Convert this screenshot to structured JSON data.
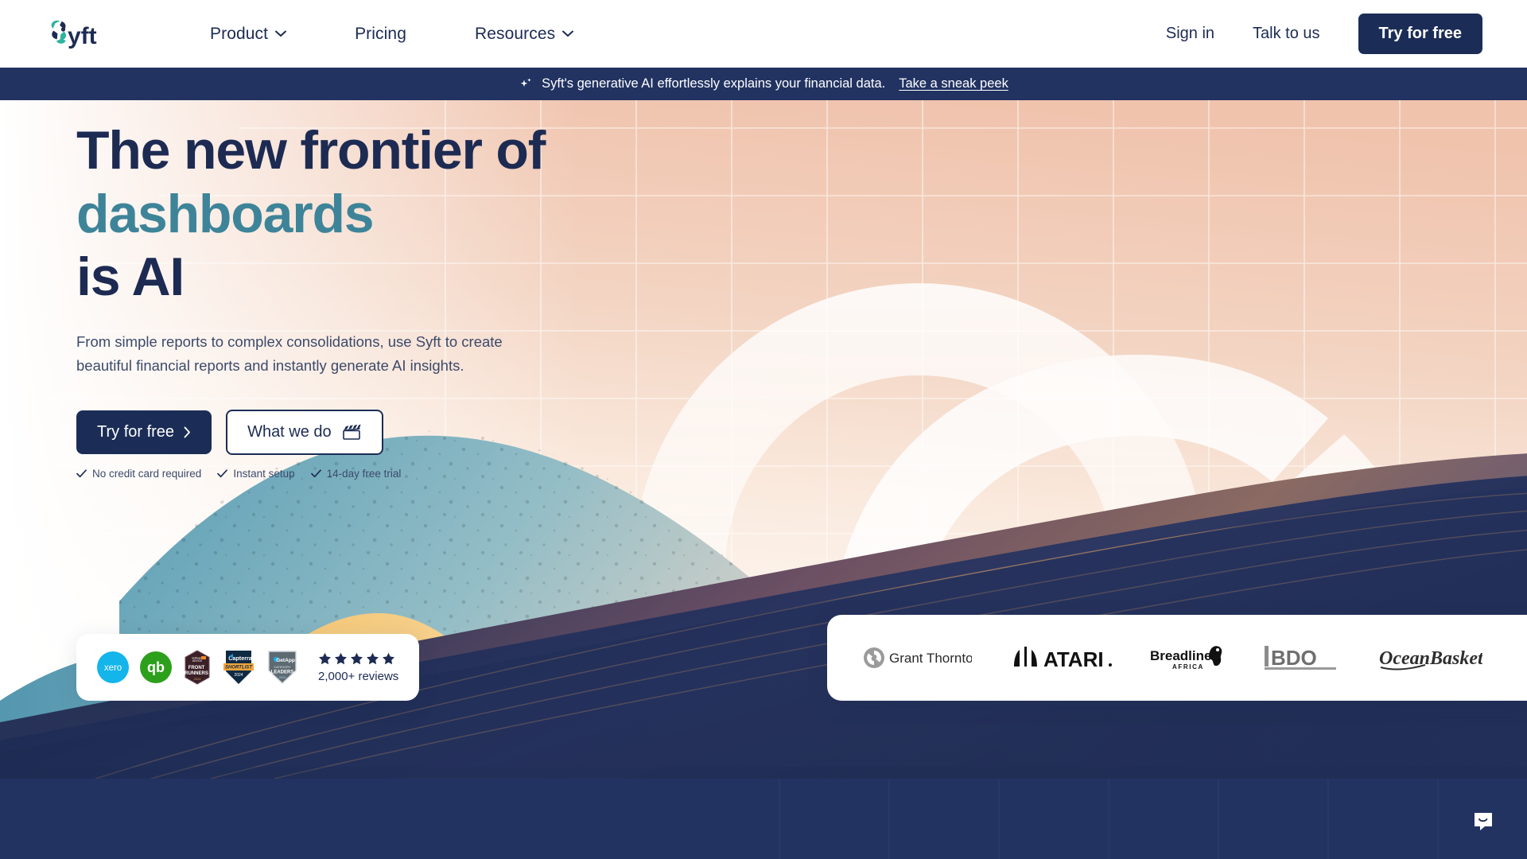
{
  "brand": {
    "name": "Syft",
    "logo_icon": "syft-logo",
    "navy": "#1d2b53",
    "teal": "#3e8499"
  },
  "nav": {
    "items": [
      {
        "label": "Product",
        "has_dropdown": true,
        "icon": "chevron-down-icon"
      },
      {
        "label": "Pricing",
        "has_dropdown": false
      },
      {
        "label": "Resources",
        "has_dropdown": true,
        "icon": "chevron-down-icon"
      }
    ],
    "sign_in": "Sign in",
    "talk_to_us": "Talk to us",
    "try_free": "Try for free"
  },
  "announcement": {
    "icon": "sparkle-icon",
    "text": "Syft's generative AI effortlessly explains your financial data.",
    "link": "Take a sneak peek"
  },
  "hero": {
    "headline_line1": "The new frontier of",
    "headline_line2": "dashboards",
    "headline_line3": "is AI",
    "subhead": "From simple reports to complex consolidations, use Syft to create beautiful financial reports and instantly generate AI insights.",
    "cta_primary": "Try for free",
    "cta_primary_icon": "chevron-right-icon",
    "cta_secondary": "What we do",
    "cta_secondary_icon": "clapperboard-icon",
    "ticks": [
      {
        "icon": "check-icon",
        "label": "No credit card required"
      },
      {
        "icon": "check-icon",
        "label": "Instant setup"
      },
      {
        "icon": "check-icon",
        "label": "14-day free trial"
      }
    ]
  },
  "reviews": {
    "badges": [
      {
        "name": "xero",
        "label": "xero",
        "type": "circle",
        "color": "#13b5ea"
      },
      {
        "name": "quickbooks",
        "label": "qb",
        "type": "circle",
        "color": "#2ca01c"
      },
      {
        "name": "software-advice-front-runners",
        "line1": "Software Advice",
        "line2": "FRONT",
        "line3": "RUNNERS",
        "year": "2024"
      },
      {
        "name": "capterra-shortlist",
        "line1": "Capterra",
        "line2": "SHORTLIST",
        "year": "2024"
      },
      {
        "name": "getapp-category-leaders",
        "line1": "GetApp",
        "line2": "CATEGORY",
        "line3": "LEADERS",
        "year": "2024"
      }
    ],
    "star_count": 5,
    "star_icon": "star-icon",
    "reviews_text": "2,000+ reviews"
  },
  "clients": {
    "logos": [
      {
        "name": "grant-thornton",
        "label": "Grant Thornton"
      },
      {
        "name": "atari",
        "label": "ATARI"
      },
      {
        "name": "breadline-africa",
        "label": "Breadline",
        "sub": "AFRICA"
      },
      {
        "name": "bdo",
        "label": "BDO"
      },
      {
        "name": "ocean-basket",
        "label": "Ocean Basket"
      }
    ]
  },
  "chat": {
    "icon": "chat-bubble-icon",
    "label": "Open chat"
  }
}
